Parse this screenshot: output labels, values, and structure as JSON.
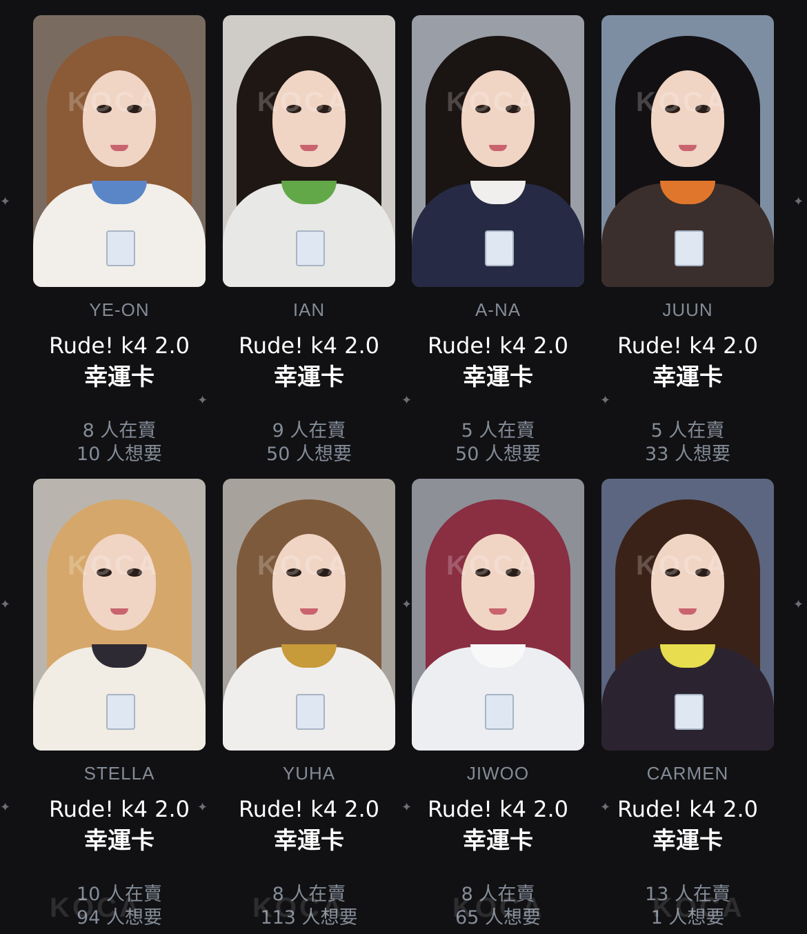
{
  "watermark": "KOCA",
  "cards": [
    {
      "member": "YE-ON",
      "title_line1": "Rude! k4 2.0",
      "title_line2": "幸運卡",
      "selling": "8 人在賣",
      "wanting": "10 人想要",
      "colors": {
        "bg": "#7a6b60",
        "hair": "#8b5a36",
        "outfit": "#f2efea",
        "collar": "#5a86c8"
      }
    },
    {
      "member": "IAN",
      "title_line1": "Rude! k4 2.0",
      "title_line2": "幸運卡",
      "selling": "9 人在賣",
      "wanting": "50 人想要",
      "colors": {
        "bg": "#cfcbc6",
        "hair": "#1e1714",
        "outfit": "#e8e8e6",
        "collar": "#62a848"
      }
    },
    {
      "member": "A-NA",
      "title_line1": "Rude! k4 2.0",
      "title_line2": "幸運卡",
      "selling": "5 人在賣",
      "wanting": "50 人想要",
      "colors": {
        "bg": "#9a9ea6",
        "hair": "#1a1413",
        "outfit": "#262a44",
        "collar": "#f0efee"
      }
    },
    {
      "member": "JUUN",
      "title_line1": "Rude! k4 2.0",
      "title_line2": "幸運卡",
      "selling": "5 人在賣",
      "wanting": "33 人想要",
      "colors": {
        "bg": "#7d8ea2",
        "hair": "#121012",
        "outfit": "#3a2f2c",
        "collar": "#e0762c"
      }
    },
    {
      "member": "STELLA",
      "title_line1": "Rude! k4 2.0",
      "title_line2": "幸運卡",
      "selling": "10 人在賣",
      "wanting": "94 人想要",
      "colors": {
        "bg": "#b9b5ae",
        "hair": "#d6a76a",
        "outfit": "#f1ece4",
        "collar": "#2e2a34"
      }
    },
    {
      "member": "YUHA",
      "title_line1": "Rude! k4 2.0",
      "title_line2": "幸運卡",
      "selling": "8 人在賣",
      "wanting": "113 人想要",
      "colors": {
        "bg": "#a8a29c",
        "hair": "#7e5a3c",
        "outfit": "#f0eeec",
        "collar": "#c79a3a"
      }
    },
    {
      "member": "JIWOO",
      "title_line1": "Rude! k4 2.0",
      "title_line2": "幸運卡",
      "selling": "8 人在賣",
      "wanting": "65 人想要",
      "colors": {
        "bg": "#8d9097",
        "hair": "#8a2e42",
        "outfit": "#eceef2",
        "collar": "#f8f8f8"
      }
    },
    {
      "member": "CARMEN",
      "title_line1": "Rude! k4 2.0",
      "title_line2": "幸運卡",
      "selling": "13 人在賣",
      "wanting": "1 人想要",
      "colors": {
        "bg": "#5c6680",
        "hair": "#3b2218",
        "outfit": "#2b2430",
        "collar": "#e7dd4e"
      }
    }
  ]
}
